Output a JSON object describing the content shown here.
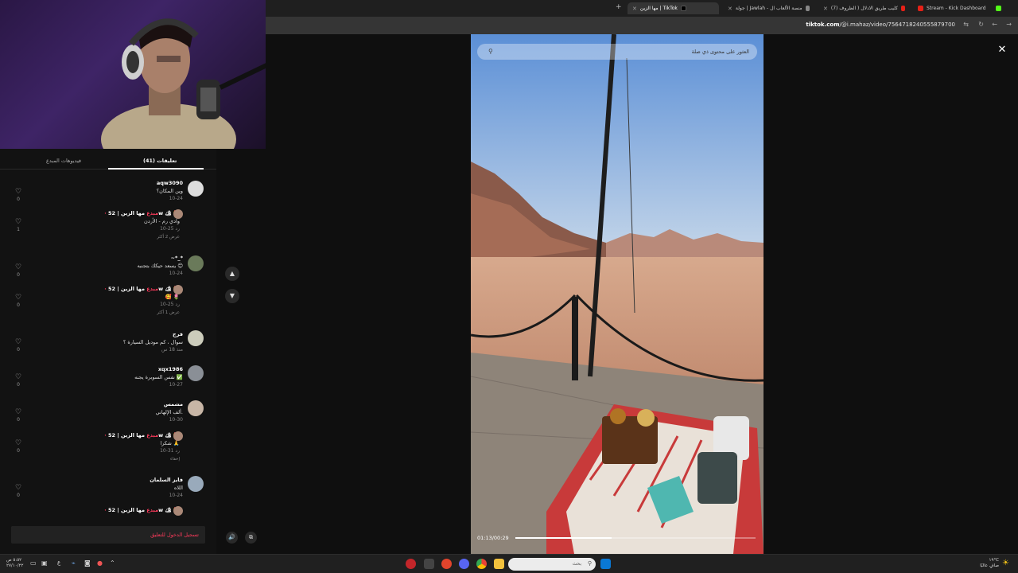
{
  "browser": {
    "tabs": [
      {
        "title": "مها الزين | TikTok",
        "active": true
      },
      {
        "title": "جولة | Jawlah - منصة الألعاب ال"
      },
      {
        "title": "(7) كليب طريق الادلال ( الظروف"
      },
      {
        "title": "Stream - Kick Dashboard"
      }
    ],
    "url_domain": "tiktok.com",
    "url_path": "/@i.mahaz/video/7564718240555879700"
  },
  "comments_panel": {
    "tab_creator_videos": "فيديوهات المبدع",
    "tab_comments": "(41) تعليقات",
    "comments": [
      {
        "name": "aqw3090",
        "text": "وين المكان؟",
        "date": "10-24",
        "reply": "رد",
        "likes": "0"
      },
      {
        "name": "مها الزين | 52w 🏕 🎁",
        "badge": "· مبدع",
        "text": "وادي رم - الأردن",
        "date": "10-25",
        "reply": "رد",
        "likes": "1",
        "more": "عرض 2 أكثر"
      },
      {
        "name": "~*_*",
        "text": "يسعد حيكك بتجنبه 😊",
        "date": "10-24",
        "reply": "رد",
        "likes": "0"
      },
      {
        "name": "مها الزين | 52w 🏕 🎁",
        "badge": "· مبدع",
        "text": "🥰 🌷",
        "date": "10-25",
        "reply": "رد",
        "likes": "0",
        "more": "عرض 1 أكثر"
      },
      {
        "name": "فرج",
        "text": "سوال ، كم موديل السيارة ؟",
        "date": "منذ 18 س",
        "reply": "رد",
        "likes": "0"
      },
      {
        "name": "xqx1986",
        "text": "نفس السوبرة يجنه ✅",
        "date": "10-27",
        "reply": "رد",
        "likes": "0"
      },
      {
        "name": "مشمس",
        "text": "ألف الإلهاني.",
        "date": "10-30",
        "reply": "رد",
        "likes": "0"
      },
      {
        "name": "مها الزين | 52w 🏕 🎁",
        "badge": "· مبدع",
        "text": "شكرا 🙏",
        "date": "10-31",
        "reply": "رد",
        "likes": "0",
        "more": "إخفاء"
      },
      {
        "name": "فايز السلمان",
        "text": "اللاه",
        "date": "10-24",
        "reply": "رد",
        "likes": "0"
      },
      {
        "name": "مها الزين | 52w 🏕 🎁",
        "badge": "· مبدع",
        "text": "",
        "date": "",
        "reply": "",
        "likes": ""
      }
    ],
    "login_prompt": "تسجيل الدخول للتعليق"
  },
  "video": {
    "search_placeholder": "العثور على محتوى ذي صلة",
    "time": "01:13/00:29",
    "progress_fraction": 0.4
  },
  "taskbar": {
    "search_text": "بحث",
    "lang": "ع",
    "time": "٥:٥٢ ص",
    "date": "٢٧/١٠/٢٢",
    "weather_temp": "١٩°C",
    "weather_text": "صافٍ عالبًا"
  },
  "colors": {
    "accent": "#ff3b5c",
    "panel_bg": "#121212"
  }
}
